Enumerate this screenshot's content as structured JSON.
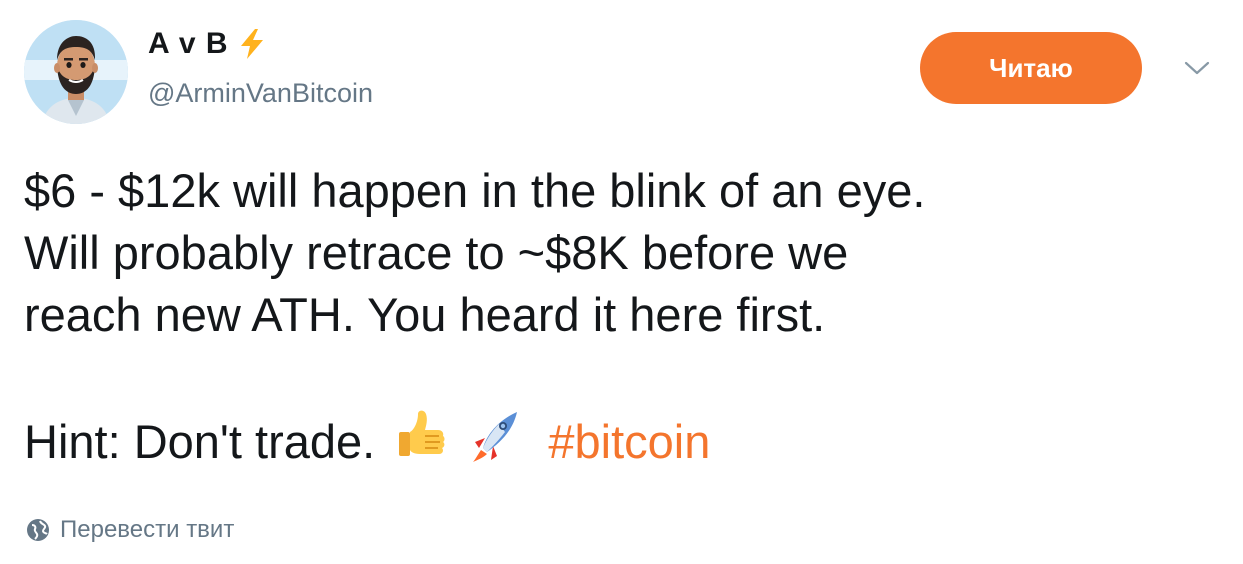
{
  "author": {
    "display_name": "A v B",
    "handle": "@ArminVanBitcoin",
    "badge_icon": "lightning-bolt-icon",
    "avatar_icon": "bearded-man-avatar"
  },
  "actions": {
    "follow_label": "Читаю",
    "menu_icon": "chevron-down-icon"
  },
  "tweet": {
    "lines": [
      "$6 - $12k will happen in the blink of an eye.",
      "Will probably retrace to ~$8K before we",
      "reach new ATH. You heard it here first."
    ],
    "hint_text": "Hint: Don't trade.",
    "emojis": [
      "thumbs-up-emoji",
      "rocket-emoji"
    ],
    "hashtag": "#bitcoin"
  },
  "translate": {
    "label": "Перевести твит",
    "icon": "globe-icon"
  },
  "colors": {
    "accent": "#f4752d",
    "text": "#14171a",
    "secondary": "#657786",
    "bolt": "#ffb21d"
  }
}
